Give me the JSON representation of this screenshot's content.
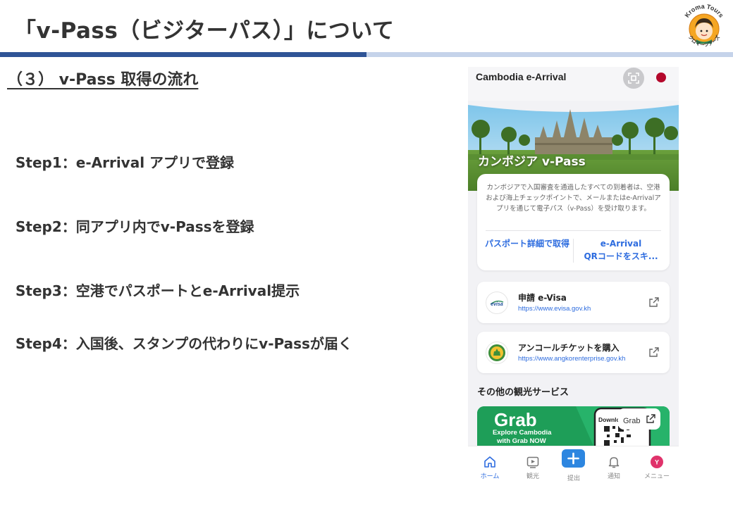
{
  "slide": {
    "title": "「v-Pass（ビジターパス）」について",
    "logo_text": "Kroma Tours",
    "logo_subtext": "クロマーツアーズ",
    "section_heading": "（３） v-Pass 取得の流れ",
    "steps": [
      "Step1：e-Arrival アプリで登録",
      "Step2：同アプリ内でv-Passを登録",
      "Step3：空港でパスポートとe-Arrival提示",
      "Step4：入国後、スタンプの代わりにv-Passが届く"
    ],
    "colors": {
      "title_bar_dark": "#2f5496",
      "title_bar_light": "#c5d3ea",
      "text": "#333333"
    }
  },
  "phone": {
    "app_title": "Cambodia e-Arrival",
    "hero_title": "カンボジア v-Pass",
    "info_text": "カンボジアで入国審査を通過したすべての到着者は、空港および海上チェックポイントで、メールまたはe-Arrivalアプリを通じて電子パス（v-Pass）を受け取ります。",
    "info_link_left": "パスポート詳細で取得",
    "info_link_right_line1": "e-Arrival",
    "info_link_right_line2": "QRコードをスキ...",
    "links": [
      {
        "title": "申請 e-Visa",
        "url": "https://www.evisa.gov.kh",
        "icon": "evisa-logo-icon",
        "icon_text": "evisa"
      },
      {
        "title": "アンコールチケットを購入",
        "url": "https://www.angkorenterprise.gov.kh",
        "icon": "angkor-enterprise-logo-icon"
      }
    ],
    "other_services_label": "その他の観光サービス",
    "grab": {
      "logo": "Grab",
      "line1": "Explore Cambodia",
      "line2": "with Grab NOW",
      "download_text": "Downlc",
      "tag": "Grab"
    },
    "nav": [
      {
        "label": "ホーム",
        "icon": "home-icon",
        "active": true
      },
      {
        "label": "観光",
        "icon": "play-icon",
        "active": false
      },
      {
        "label": "提出",
        "icon": "plus-icon",
        "active": false
      },
      {
        "label": "通知",
        "icon": "bell-icon",
        "active": false
      },
      {
        "label": "メニュー",
        "icon": "avatar-icon",
        "active": false,
        "avatar_letter": "Y"
      }
    ],
    "colors": {
      "accent": "#2d6cdf",
      "flag": "#b4082c",
      "grab_green": "#1e9e58",
      "avatar": "#e0336b"
    }
  }
}
